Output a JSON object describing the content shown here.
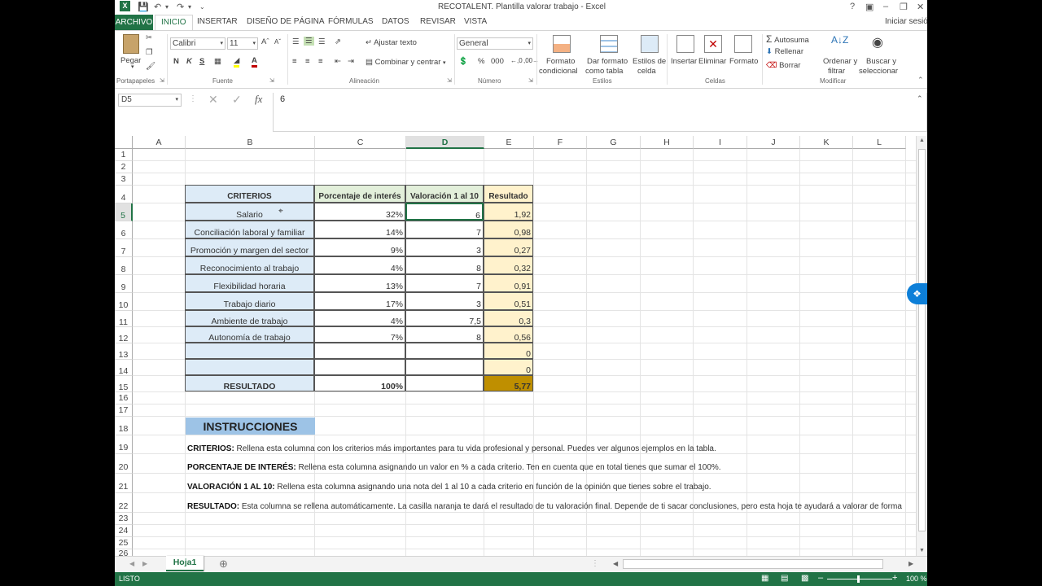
{
  "window": {
    "title": "RECOTALENT. Plantilla valorar trabajo - Excel",
    "user": "Iniciar sesió"
  },
  "tabs": [
    "ARCHIVO",
    "INICIO",
    "INSERTAR",
    "DISEÑO DE PÁGINA",
    "FÓRMULAS",
    "DATOS",
    "REVISAR",
    "VISTA"
  ],
  "ribbon": {
    "paste": "Pegar",
    "font_name": "Calibri",
    "font_size": "11",
    "wrap": "Ajustar texto",
    "merge": "Combinar y centrar",
    "number_format": "General",
    "cond_format_1": "Formato",
    "cond_format_2": "condicional",
    "table_format_1": "Dar formato",
    "table_format_2": "como tabla",
    "cell_styles_1": "Estilos de",
    "cell_styles_2": "celda",
    "insert": "Insertar",
    "delete": "Eliminar",
    "format": "Formato",
    "autosum": "Autosuma",
    "fill": "Rellenar",
    "clear": "Borrar",
    "sort_1": "Ordenar y",
    "sort_2": "filtrar",
    "find_1": "Buscar y",
    "find_2": "seleccionar",
    "groups": {
      "clipboard": "Portapapeles",
      "font": "Fuente",
      "alignment": "Alineación",
      "number": "Número",
      "styles": "Estilos",
      "cells": "Celdas",
      "editing": "Modificar"
    }
  },
  "formula_bar": {
    "name_box": "D5",
    "value": "6"
  },
  "columns": [
    "A",
    "B",
    "C",
    "D",
    "E",
    "F",
    "G",
    "H",
    "I",
    "J",
    "K",
    "L"
  ],
  "rows": [
    "1",
    "2",
    "3",
    "4",
    "5",
    "6",
    "7",
    "8",
    "9",
    "10",
    "11",
    "12",
    "13",
    "14",
    "15",
    "16",
    "17",
    "18",
    "19",
    "20",
    "21",
    "22",
    "23",
    "24",
    "25",
    "26"
  ],
  "table": {
    "headers": [
      "CRITERIOS",
      "Porcentaje de interés",
      "Valoración 1 al 10",
      "Resultado"
    ],
    "rows": [
      [
        "Salario",
        "32%",
        "6",
        "1,92"
      ],
      [
        "Conciliación laboral y familiar",
        "14%",
        "7",
        "0,98"
      ],
      [
        "Promoción y margen del sector",
        "9%",
        "3",
        "0,27"
      ],
      [
        "Reconocimiento al trabajo",
        "4%",
        "8",
        "0,32"
      ],
      [
        "Flexibilidad horaria",
        "13%",
        "7",
        "0,91"
      ],
      [
        "Trabajo diario",
        "17%",
        "3",
        "0,51"
      ],
      [
        "Ambiente de trabajo",
        "4%",
        "7,5",
        "0,3"
      ],
      [
        "Autonomía de trabajo",
        "7%",
        "8",
        "0,56"
      ],
      [
        "",
        "",
        "",
        "0"
      ],
      [
        "",
        "",
        "",
        "0"
      ]
    ],
    "total": [
      "RESULTADO",
      "100%",
      "",
      "5,77"
    ]
  },
  "instructions": {
    "title": "INSTRUCCIONES",
    "lines": [
      {
        "bold": "CRITERIOS:",
        "text": " Rellena esta columna con los criterios más importantes para tu vida profesional y personal. Puedes ver algunos ejemplos en la tabla."
      },
      {
        "bold": "PORCENTAJE DE INTERÉS:",
        "text": " Rellena esta columna asignando un valor en % a cada criterio. Ten en cuenta que en total tienes que sumar el 100%."
      },
      {
        "bold": "VALORACIÓN 1 AL 10:",
        "text": " Rellena esta columna asignando una nota del 1 al 10 a cada criterio en función de la opinión que tienes sobre el trabajo."
      },
      {
        "bold": "RESULTADO:",
        "text": " Esta columna se rellena automáticamente. La casilla naranja te dará el resultado de tu valoración final. Depende de ti sacar conclusiones, pero esta hoja te ayudará a valorar de forma"
      }
    ]
  },
  "sheet_tab": "Hoja1",
  "status": {
    "mode": "LISTO",
    "zoom": "100 %"
  },
  "colors": {
    "excel_green": "#217346",
    "blue": "#ddebf7",
    "green": "#e2efda",
    "yellow": "#fff2cc",
    "orange": "#bf8f00"
  }
}
